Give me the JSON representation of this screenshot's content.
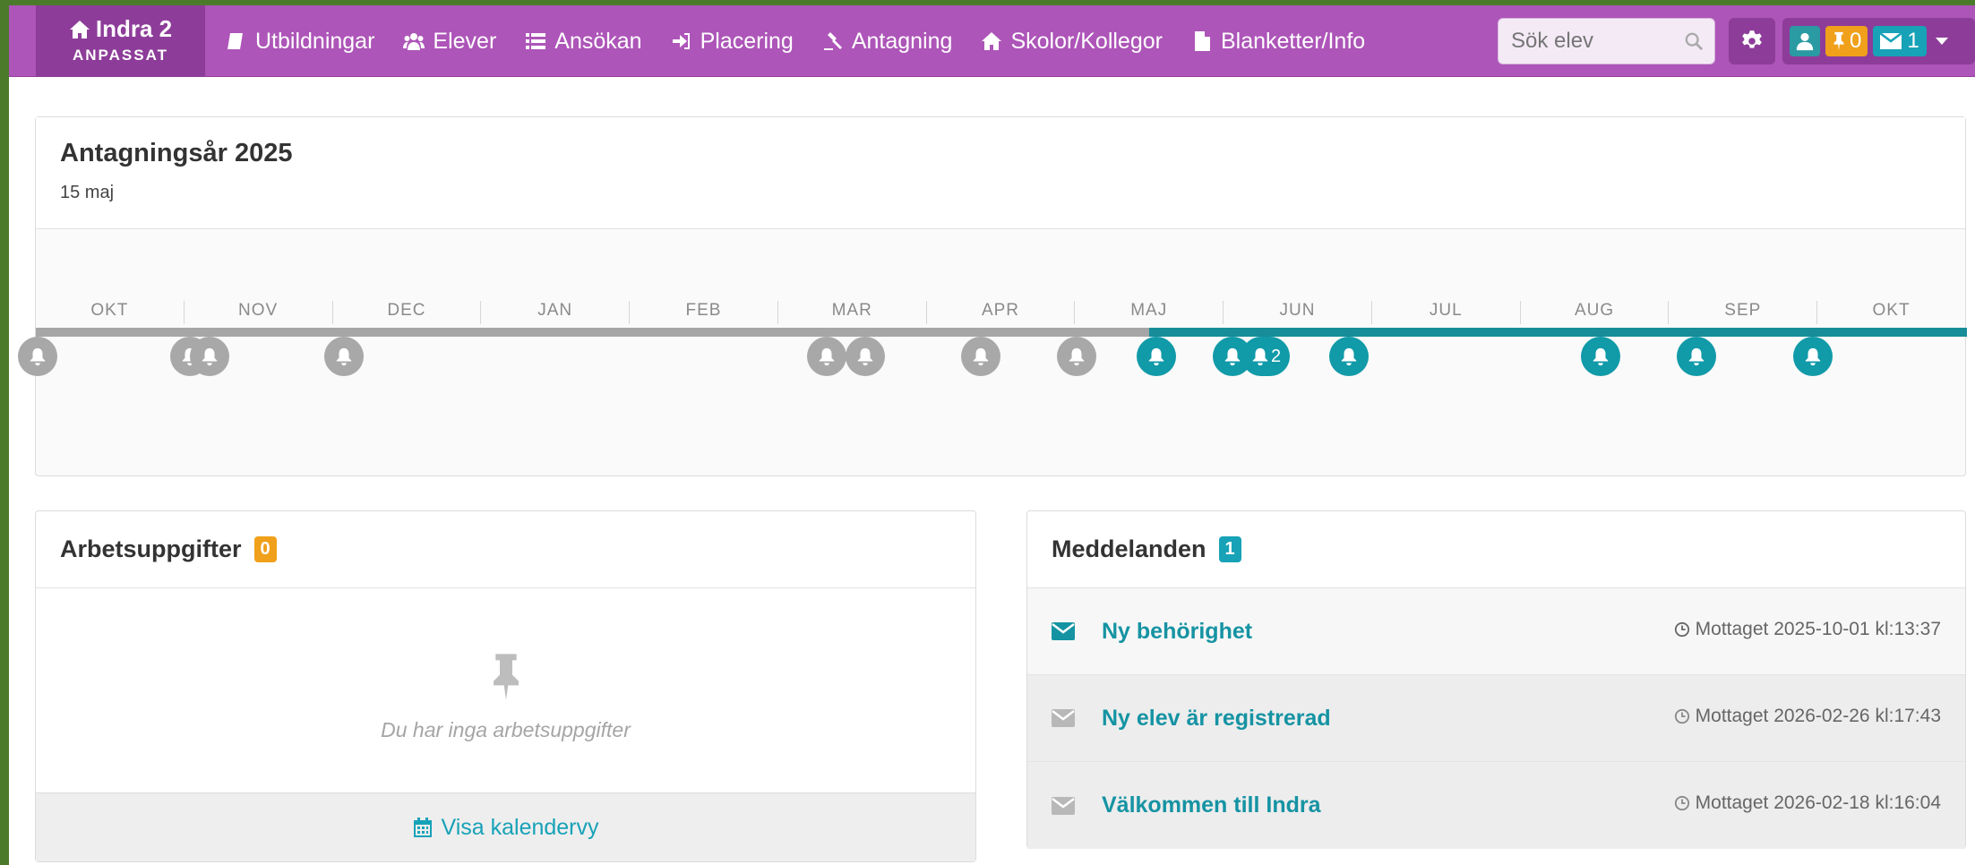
{
  "brand": {
    "title": "Indra 2",
    "subtitle": "ANPASSAT"
  },
  "nav": [
    {
      "label": "Utbildningar",
      "icon": "book-icon"
    },
    {
      "label": "Elever",
      "icon": "users-icon"
    },
    {
      "label": "Ansökan",
      "icon": "list-icon"
    },
    {
      "label": "Placering",
      "icon": "sign-in-icon"
    },
    {
      "label": "Antagning",
      "icon": "gavel-icon"
    },
    {
      "label": "Skolor/Kollegor",
      "icon": "home-icon"
    },
    {
      "label": "Blanketter/Info",
      "icon": "file-icon"
    }
  ],
  "search": {
    "placeholder": "Sök elev"
  },
  "user": {
    "pin_count": "0",
    "message_count": "1"
  },
  "timeline": {
    "title": "Antagningsår 2025",
    "date": "15 maj",
    "months": [
      "OKT",
      "NOV",
      "DEC",
      "JAN",
      "FEB",
      "MAR",
      "APR",
      "MAJ",
      "JUN",
      "JUL",
      "AUG",
      "SEP",
      "OKT"
    ],
    "bell_group_label": "2",
    "colors": {
      "past": "#a6a6a6",
      "future": "#168d99"
    }
  },
  "tasks": {
    "title": "Arbetsuppgifter",
    "count": "0",
    "empty_text": "Du har inga arbetsuppgifter",
    "calendar_link": "Visa kalendervy"
  },
  "messages": {
    "title": "Meddelanden",
    "count": "1",
    "items": [
      {
        "subject": "Ny behörighet",
        "received": "Mottaget 2025-10-01 kl:13:37",
        "unread": true
      },
      {
        "subject": "Ny elev är registrerad",
        "received": "Mottaget 2026-02-26 kl:17:43",
        "unread": false
      },
      {
        "subject": "Välkommen till Indra",
        "received": "Mottaget 2026-02-18 kl:16:04",
        "unread": false
      }
    ]
  }
}
